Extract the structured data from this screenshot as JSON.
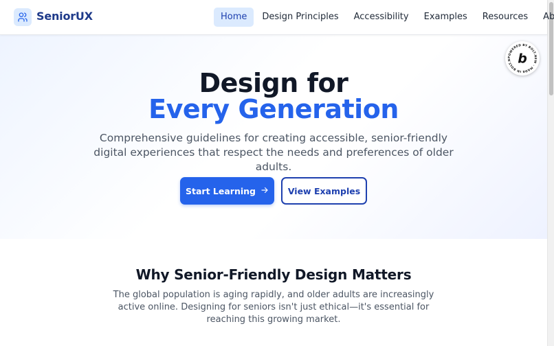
{
  "brand": {
    "name": "SeniorUX",
    "icon": "users-icon",
    "accent_color": "#2563eb",
    "dark_color": "#1e3a8a"
  },
  "nav": {
    "items": [
      {
        "label": "Home",
        "active": true
      },
      {
        "label": "Design Principles",
        "active": false
      },
      {
        "label": "Accessibility",
        "active": false
      },
      {
        "label": "Examples",
        "active": false
      },
      {
        "label": "Resources",
        "active": false
      },
      {
        "label": "About",
        "active": false
      }
    ]
  },
  "hero": {
    "title_line1": "Design for",
    "title_line2": "Every Generation",
    "subtitle": "Comprehensive guidelines for creating accessible, senior-friendly digital experiences that respect the needs and preferences of older adults.",
    "primary_button": "Start Learning",
    "primary_button_icon": "arrow-right-icon",
    "secondary_button": "View Examples"
  },
  "badge": {
    "text": "POWERED BY BOLT.NEW · MADE IN BOLT.NEW ·",
    "letter": "b"
  },
  "why": {
    "title": "Why Senior-Friendly Design Matters",
    "body": "The global population is aging rapidly, and older adults are increasingly active online. Designing for seniors isn't just ethical—it's essential for reaching this growing market."
  }
}
